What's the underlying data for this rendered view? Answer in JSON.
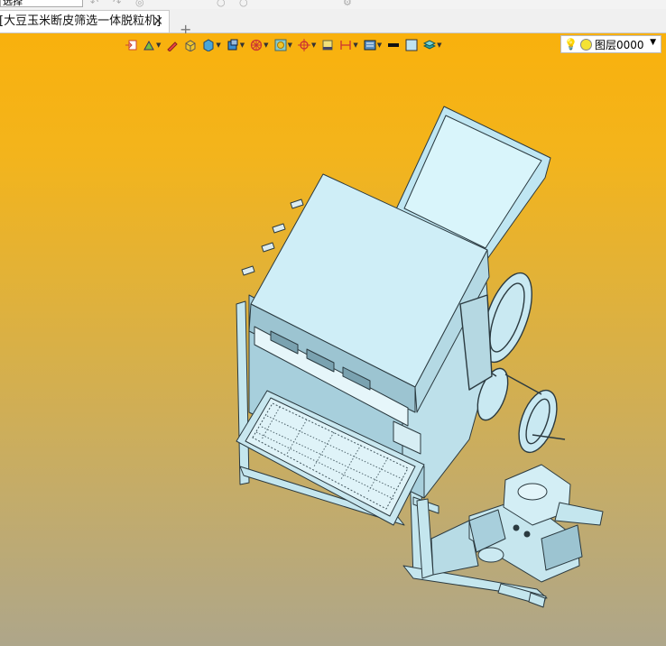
{
  "topbar": {
    "select_label": "选择"
  },
  "tab": {
    "title": "[大豆玉米断皮筛选一体脱粒机]",
    "close": "✕",
    "add": "+"
  },
  "toolbar": {
    "items": [
      "import-icon",
      "paint-icon",
      "pen-icon",
      "box-solid-icon",
      "cube-icon",
      "cube-view-icon",
      "wheel-icon",
      "render-icon",
      "snap-icon",
      "frame-icon",
      "dimension-icon",
      "display-mode-icon",
      "line-color-icon",
      "fill-color-icon",
      "layers-icon"
    ],
    "layer_name": "图层0000",
    "layer_dropdown": "▼"
  },
  "colors": {
    "accent": "#f9b10d",
    "model": "#c9e9f2",
    "model_dark": "#9fc5d2"
  }
}
